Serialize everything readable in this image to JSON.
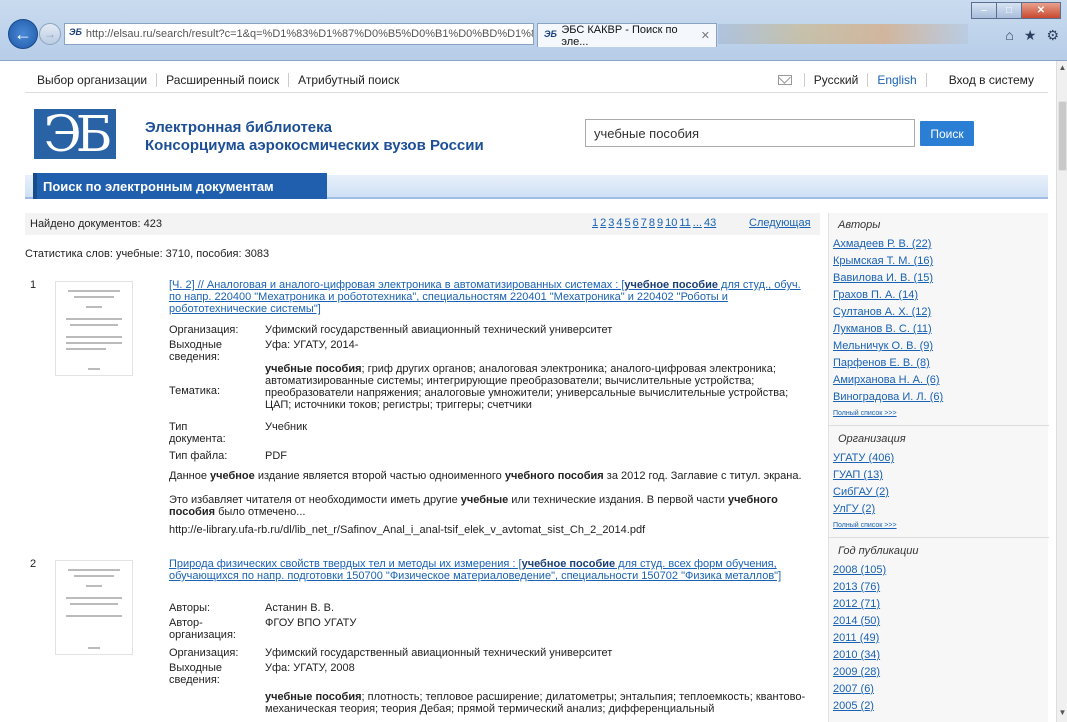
{
  "browser": {
    "address": "http://elsau.ru/search/result?c=1&q=%D1%83%D1%87%D0%B5%D0%B1%D0%BD%D1%8B",
    "tab_title": "ЭБС КАКВР - Поиск по эле...",
    "favicon_text": "ЭБ"
  },
  "topbar": {
    "items": [
      "Выбор организации",
      "Расширенный поиск",
      "Атрибутный поиск"
    ],
    "lang_ru": "Русский",
    "lang_en": "English",
    "login": "Вход в систему"
  },
  "header": {
    "logo_text": "ЭБ",
    "title_line1": "Электронная библиотека",
    "title_line2": "Консорциума аэрокосмических вузов России",
    "search_value": "учебные пособия",
    "search_button": "Поиск",
    "section_tab": "Поиск по электронным документам"
  },
  "results_meta": {
    "found": "Найдено документов: 423",
    "pages": [
      "1",
      "2",
      "3",
      "4",
      "5",
      "6",
      "7",
      "8",
      "9",
      "10",
      "11",
      "...",
      "43"
    ],
    "next": "Следующая",
    "stats": "Статистика слов: учебные: 3710, пособия: 3083"
  },
  "results": [
    {
      "num": "1",
      "title_pre": "[Ч. 2] // Аналоговая и аналого-цифровая электроника в автоматизированных системах : [",
      "title_hl": "учебное пособие",
      "title_post": " для студ., обуч. по напр. 220400 \"Мехатроника и робототехника\", специальностям 220401 \"Мехатроника\" и 220402 \"Роботы и робототехнические системы\"]",
      "org_label": "Организация:",
      "org": "Уфимский государственный авиационный технический университет",
      "pub_label": "Выходные сведения:",
      "pub": "Уфа: УГАТУ, 2014-",
      "topic_label": "Тематика:",
      "topic_hl": "учебные пособия",
      "topic": "; гриф других органов; аналоговая электроника; аналого-цифровая электроника; автоматизированные системы; интегрирующие преобразователи; вычислительные устройства; преобразователи напряжения; аналоговые умножители; универсальные вычислительные устройства; ЦАП; источники токов; регистры; триггеры; счетчики",
      "type_label": "Тип документа:",
      "type": "Учебник",
      "file_label": "Тип файла:",
      "file": "PDF",
      "desc1_a": "Данное ",
      "desc1_b": "учебное",
      "desc1_c": " издание является второй частью одноименного ",
      "desc1_d": "учебного пособия",
      "desc1_e": " за 2012 год. Заглавие с титул. экрана.",
      "desc2_a": "Это избавляет читателя от необходимости иметь другие ",
      "desc2_b": "учебные",
      "desc2_c": " или технические издания. В первой части ",
      "desc2_d": "учебного пособия",
      "desc2_e": " было отмечено...",
      "url": "http://e-library.ufa-rb.ru/dl/lib_net_r/Safinov_Anal_i_anal-tsif_elek_v_avtomat_sist_Ch_2_2014.pdf"
    },
    {
      "num": "2",
      "title_pre": "Природа физических свойств твердых тел и методы их измерения : [",
      "title_hl": "учебное пособие",
      "title_post": " для студ. всех форм обучения, обучающихся по напр. подготовки 150700 \"Физическое материаловедение\", специальности 150702 \"Физика металлов\"]",
      "authors_label": "Авторы:",
      "authors": "Астанин В. В.",
      "aorg_label": "Автор-организация:",
      "aorg": "ФГОУ ВПО УГАТУ",
      "org_label": "Организация:",
      "org": "Уфимский государственный авиационный технический университет",
      "pub_label": "Выходные сведения:",
      "pub": "Уфа: УГАТУ, 2008",
      "topic_hl": "учебные пособия",
      "topic": "; плотность; тепловое расширение; дилатометры; энтальпия; теплоемкость; квантово-механическая теория; теория Дебая; прямой термический анализ; дифференциальный"
    }
  ],
  "sidebar": {
    "authors_title": "Авторы",
    "authors": [
      "Ахмадеев Р. В. (22)",
      "Крымская Т. М. (16)",
      "Вавилова И. В. (15)",
      "Грахов П. А. (14)",
      "Султанов А. Х. (12)",
      "Лукманов В. С. (11)",
      "Мельничук О. В. (9)",
      "Парфенов Е. В. (8)",
      "Амирханова Н. А. (6)",
      "Виноградова И. Л. (6)"
    ],
    "full_list": "Полный список >>>",
    "org_title": "Организация",
    "orgs": [
      "УГАТУ (406)",
      "ГУАП (13)",
      "СибГАУ (2)",
      "УлГУ (2)"
    ],
    "year_title": "Год публикации",
    "years": [
      "2008 (105)",
      "2013 (76)",
      "2012 (71)",
      "2014 (50)",
      "2011 (49)",
      "2010 (34)",
      "2009 (28)",
      "2007 (6)",
      "2005 (2)"
    ]
  }
}
